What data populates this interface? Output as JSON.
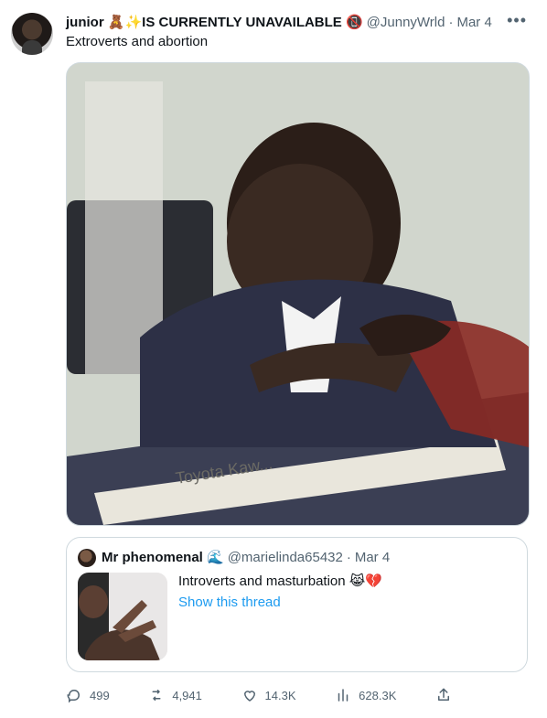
{
  "tweet": {
    "author": {
      "display_name": "junior 🧸✨IS CURRENTLY UNAVAILABLE 📵",
      "handle": "@JunnyWrld",
      "date": "Mar 4"
    },
    "text": "Extroverts and abortion",
    "media": {
      "alt": "meme image: boy in suit shaking hands at desk",
      "nameplate_text": "Toyota Kaw..."
    },
    "more_icon": "more-horizontal-icon"
  },
  "quote": {
    "author": {
      "display_name": "Mr phenomenal 🌊",
      "handle": "@marielinda65432",
      "date": "Mar 4"
    },
    "text": "Introverts and masturbation 😹💔",
    "link": "Show this thread"
  },
  "actions": [
    {
      "name": "reply",
      "icon": "reply-icon",
      "count": "499"
    },
    {
      "name": "retweet",
      "icon": "retweet-icon",
      "count": "4,941"
    },
    {
      "name": "like",
      "icon": "heart-icon",
      "count": "14.3K"
    },
    {
      "name": "views",
      "icon": "views-icon",
      "count": "628.3K"
    },
    {
      "name": "share",
      "icon": "share-icon",
      "count": ""
    }
  ],
  "colors": {
    "text": "#0f1419",
    "muted": "#536471",
    "link": "#1d9bf0",
    "border": "#cfd9de"
  }
}
